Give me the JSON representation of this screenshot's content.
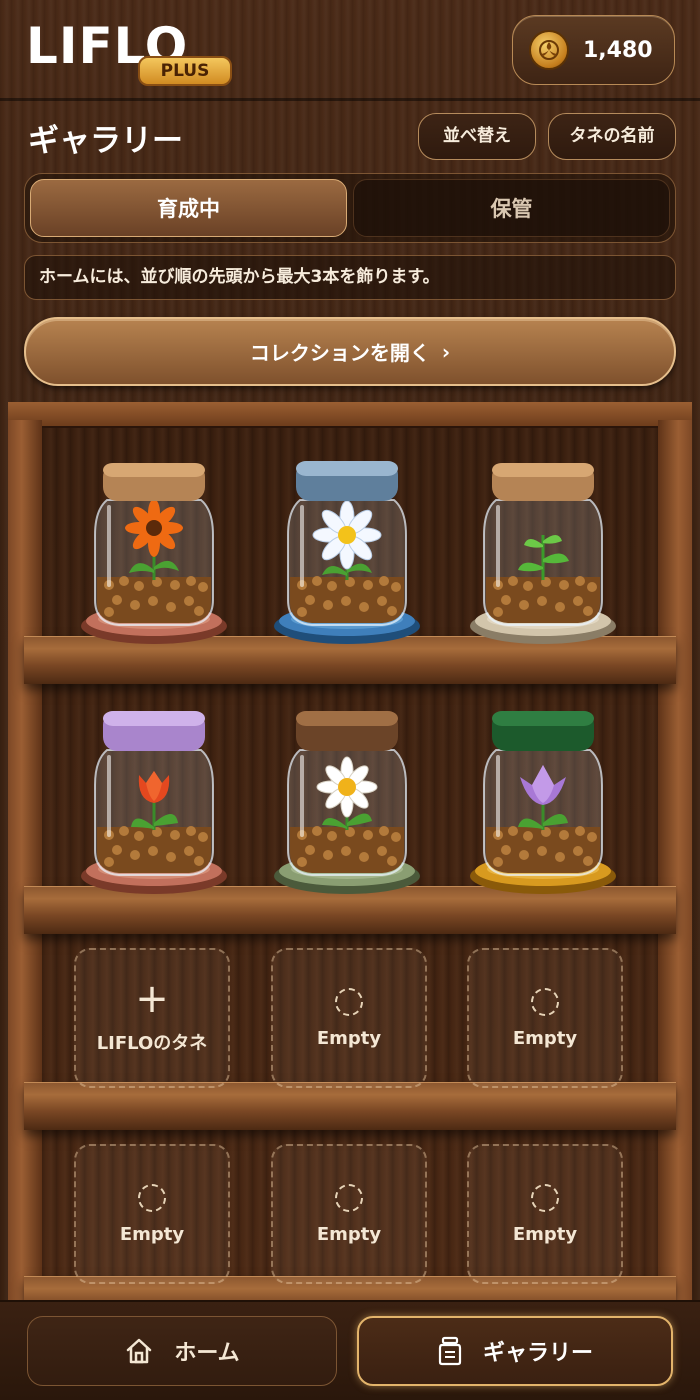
{
  "header": {
    "logo_text": "LIFLO",
    "logo_badge": "PLUS",
    "coin_icon": "coin-icon",
    "coin_amount": "1,480"
  },
  "gallery": {
    "title": "ギャラリー",
    "sort_label": "並べ替え",
    "seed_name_label": "タネの名前",
    "tabs": [
      {
        "label": "育成中",
        "active": true
      },
      {
        "label": "保管",
        "active": false
      }
    ],
    "info_text": "ホームには、並び順の先頭から最大3本を飾ります。",
    "collection_button": "コレクションを開く",
    "collection_chevron": "›"
  },
  "shelf": {
    "jars": [
      {
        "flower": "orange-gerbera",
        "lid": "wood",
        "coaster": "terracotta"
      },
      {
        "flower": "white-daisy",
        "lid": "blue-metal",
        "coaster": "blue"
      },
      {
        "flower": "sprout",
        "lid": "wood",
        "coaster": "beige"
      },
      {
        "flower": "red-tulip",
        "lid": "lavender",
        "coaster": "terracotta"
      },
      {
        "flower": "white-daisy",
        "lid": "bronze",
        "coaster": "sage"
      },
      {
        "flower": "purple-tulip",
        "lid": "green",
        "coaster": "amber"
      }
    ],
    "slots": [
      {
        "label": "LIFLOのタネ",
        "icon": "plus-icon"
      },
      {
        "label": "Empty",
        "icon": "empty-circle-icon"
      },
      {
        "label": "Empty",
        "icon": "empty-circle-icon"
      },
      {
        "label": "Empty",
        "icon": "empty-circle-icon"
      },
      {
        "label": "Empty",
        "icon": "empty-circle-icon"
      },
      {
        "label": "Empty",
        "icon": "empty-circle-icon"
      }
    ]
  },
  "nav": {
    "home_label": "ホーム",
    "home_icon": "home-icon",
    "gallery_label": "ギャラリー",
    "gallery_icon": "jar-icon"
  },
  "colors": {
    "accent": "#e3b46b",
    "background": "#3d2313"
  }
}
